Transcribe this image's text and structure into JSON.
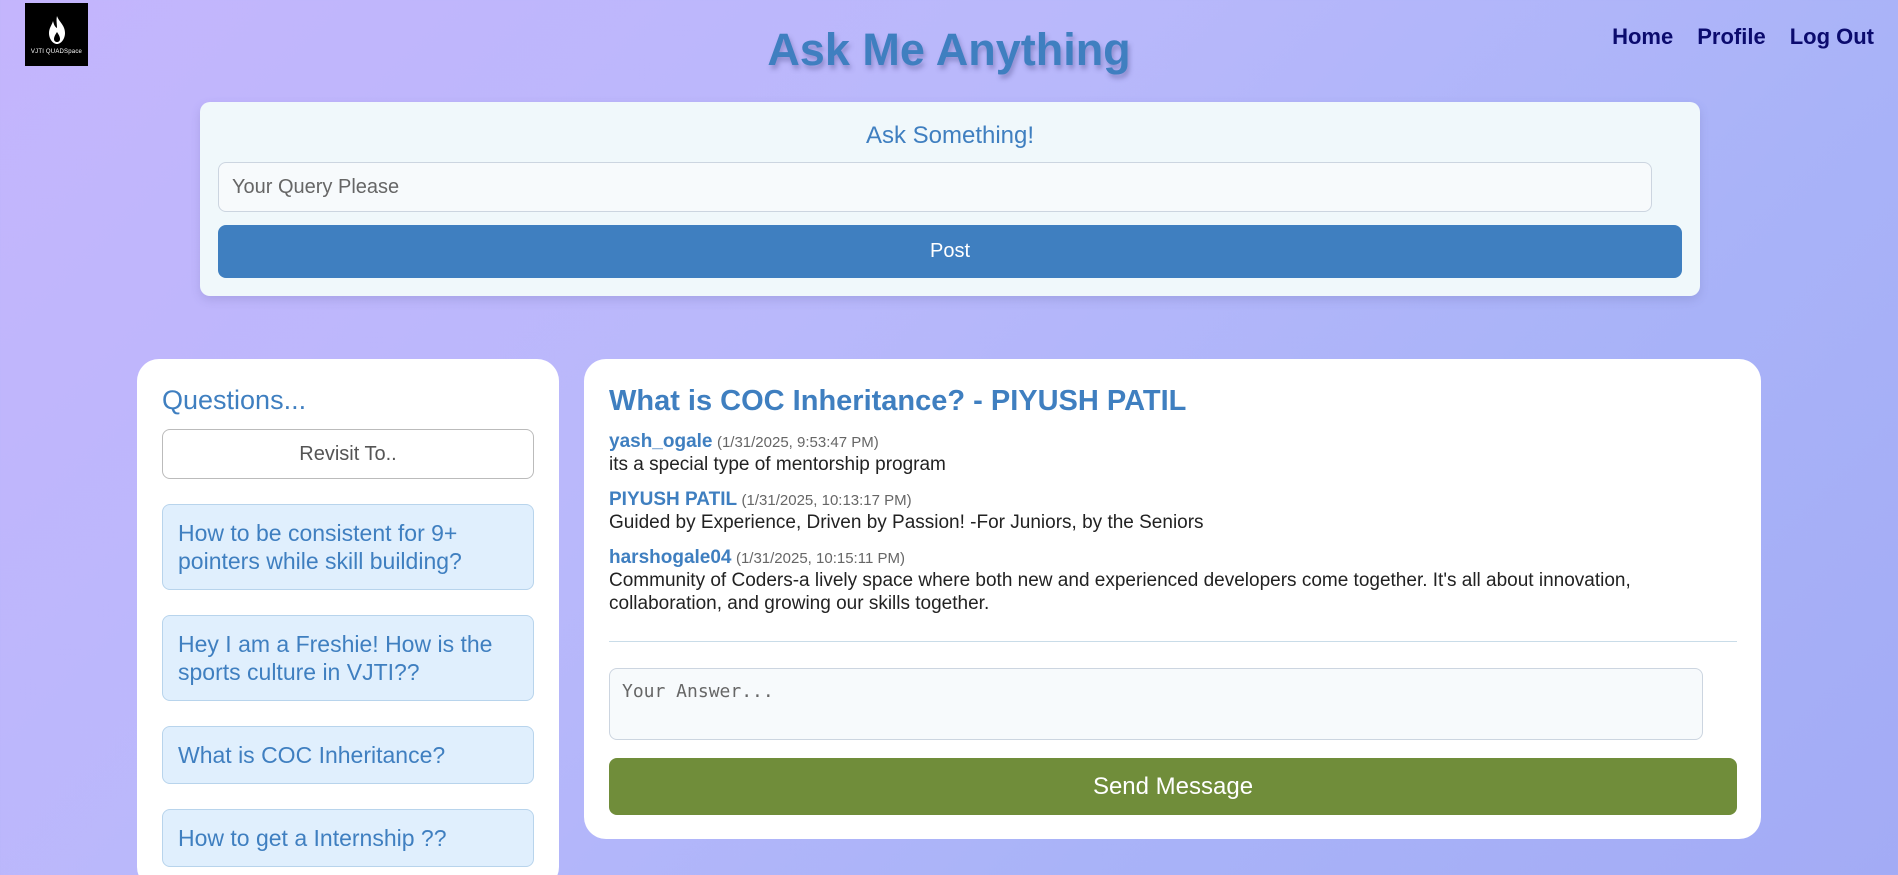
{
  "brand": {
    "logo_text": "VJTI QUADSpace",
    "logo_icon": "flame-icon"
  },
  "header": {
    "title": "Ask Me Anything"
  },
  "nav": {
    "home": "Home",
    "profile": "Profile",
    "logout": "Log Out"
  },
  "ask": {
    "title": "Ask Something!",
    "placeholder": "Your Query Please",
    "post_label": "Post"
  },
  "questions": {
    "title": "Questions...",
    "revisit_label": "Revisit To..",
    "items": [
      "How to be consistent for 9+ pointers while skill building?",
      "Hey I am a Freshie! How is the sports culture in VJTI??",
      "What is COC Inheritance?",
      "How to get a Internship ??"
    ]
  },
  "thread": {
    "title": "What is COC Inheritance? - PIYUSH PATIL",
    "messages": [
      {
        "user": "yash_ogale",
        "time": "(1/31/2025, 9:53:47 PM)",
        "text": "its a special type of mentorship program"
      },
      {
        "user": "PIYUSH PATIL",
        "time": "(1/31/2025, 10:13:17 PM)",
        "text": "Guided by Experience, Driven by Passion! -For Juniors, by the Seniors"
      },
      {
        "user": "harshogale04",
        "time": "(1/31/2025, 10:15:11 PM)",
        "text": "Community of Coders-a lively space where both new and experienced developers come together. It's all about innovation, collaboration, and growing our skills together."
      }
    ],
    "answer_placeholder": "Your Answer...",
    "send_label": "Send Message"
  },
  "colors": {
    "accent": "#3f7fc0",
    "send": "#708d3a",
    "nav": "#0b0b6e"
  }
}
